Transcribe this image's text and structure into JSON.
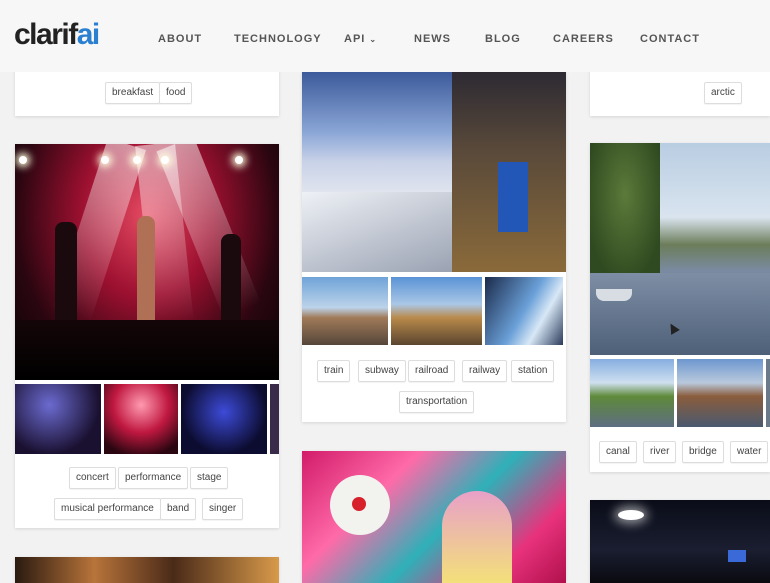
{
  "brand": {
    "logo_main": "clarif",
    "logo_accent": "ai",
    "accent_color": "#2a7fd0"
  },
  "nav": {
    "items": [
      {
        "label": "ABOUT"
      },
      {
        "label": "TECHNOLOGY"
      },
      {
        "label": "API"
      },
      {
        "label": "NEWS"
      },
      {
        "label": "BLOG"
      },
      {
        "label": "CAREERS"
      },
      {
        "label": "CONTACT"
      }
    ],
    "api_caret": "⌄"
  },
  "cards": {
    "food": {
      "tags": [
        "breakfast",
        "food"
      ]
    },
    "arctic": {
      "tags": [
        "arctic"
      ]
    },
    "concert": {
      "tags": [
        "concert",
        "performance",
        "stage",
        "musical performance",
        "band",
        "singer"
      ]
    },
    "train": {
      "tags": [
        "train",
        "subway",
        "railroad",
        "railway",
        "station",
        "transportation"
      ]
    },
    "canal": {
      "tags": [
        "canal",
        "river",
        "bridge",
        "water"
      ]
    }
  }
}
